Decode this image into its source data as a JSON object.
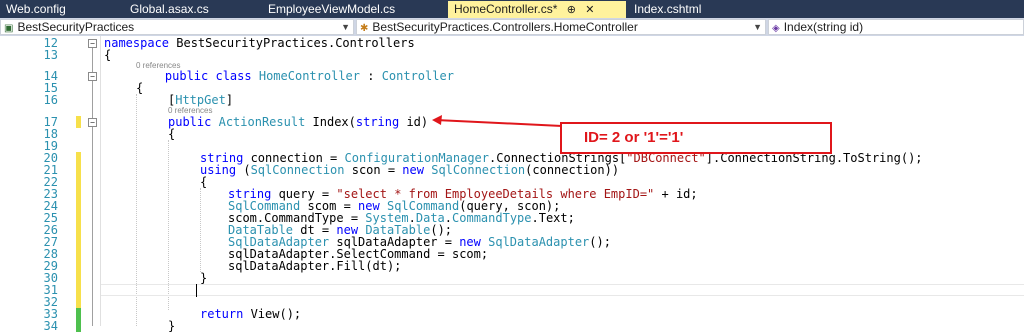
{
  "tabs": [
    {
      "label": "Web.config",
      "active": false
    },
    {
      "label": "Global.asax.cs",
      "active": false
    },
    {
      "label": "EmployeeViewModel.cs",
      "active": false
    },
    {
      "label": "HomeController.cs*",
      "active": true,
      "pin": "⊕",
      "close": "✕"
    },
    {
      "label": "Index.cshtml",
      "active": false
    }
  ],
  "navbar": {
    "project": "BestSecurityPractices",
    "class_path": "BestSecurityPractices.Controllers.HomeController",
    "member": "Index(string id)"
  },
  "editor": {
    "line_numbers": [
      "12",
      "13",
      "14",
      "15",
      "16",
      "17",
      "18",
      "19",
      "20",
      "21",
      "22",
      "23",
      "24",
      "25",
      "26",
      "27",
      "28",
      "29",
      "30",
      "31",
      "32",
      "33",
      "34"
    ],
    "references_label": "0 references",
    "callout_text": "ID= 2 or '1'='1'"
  },
  "colors": {
    "tabbar": "#293955",
    "active_tab": "#fff29d",
    "keyword": "#0000ff",
    "type": "#2b91af",
    "string": "#a31515",
    "change_yellow": "#f7e04b",
    "change_green": "#4ec04e",
    "callout_red": "#e0161b"
  },
  "icons": {
    "project": "csharp-project-icon",
    "class": "class-icon",
    "method": "method-icon"
  }
}
